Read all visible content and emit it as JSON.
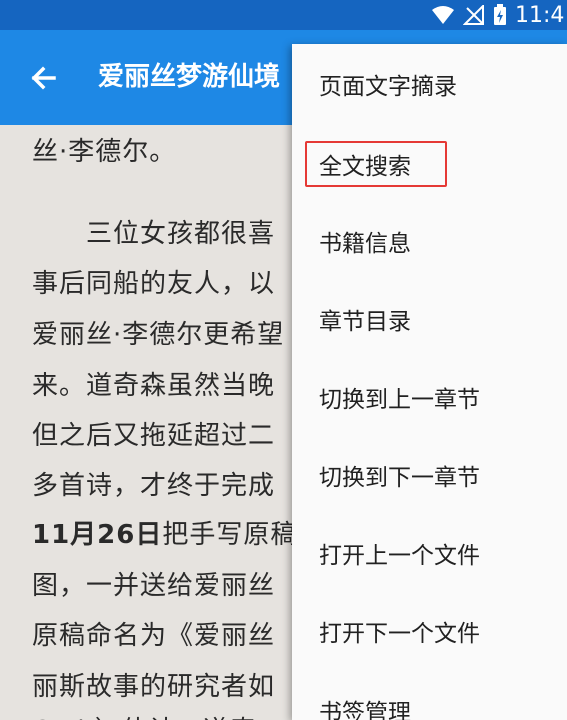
{
  "status_bar": {
    "time": "11:4",
    "icons": [
      "wifi-icon",
      "no-signal-icon",
      "battery-charging-icon"
    ]
  },
  "app_bar": {
    "title": "爱丽丝梦游仙境",
    "back_icon": "back-arrow-icon"
  },
  "reader": {
    "line1": "丝·李德尔。",
    "line2": "三位女孩都很喜",
    "line3": "事后同船的友人，以",
    "line4": "爱丽丝·李德尔更希望",
    "line5": "来。道奇森虽然当晚",
    "line6": "但之后又拖延超过二",
    "line7": "多首诗，才终于完成",
    "line8_bold": "11月26日",
    "line8_rest": "把手写原稿",
    "line9": "图，一并送给爱丽丝",
    "line10": "原稿命名为《爱丽丝",
    "line11": "丽斯故事的研究者如",
    "line12": "Cod       ）体认，道奇"
  },
  "menu": {
    "items": [
      {
        "label": "页面文字摘录"
      },
      {
        "label": "全文搜索"
      },
      {
        "label": "书籍信息"
      },
      {
        "label": "章节目录"
      },
      {
        "label": "切换到上一章节"
      },
      {
        "label": "切换到下一章节"
      },
      {
        "label": "打开上一个文件"
      },
      {
        "label": "打开下一个文件"
      },
      {
        "label": "书签管理"
      }
    ]
  },
  "colors": {
    "status_bar": "#1565c0",
    "app_bar": "#1e88e5",
    "highlight": "#e53935",
    "reader_bg": "#e6e3df"
  }
}
